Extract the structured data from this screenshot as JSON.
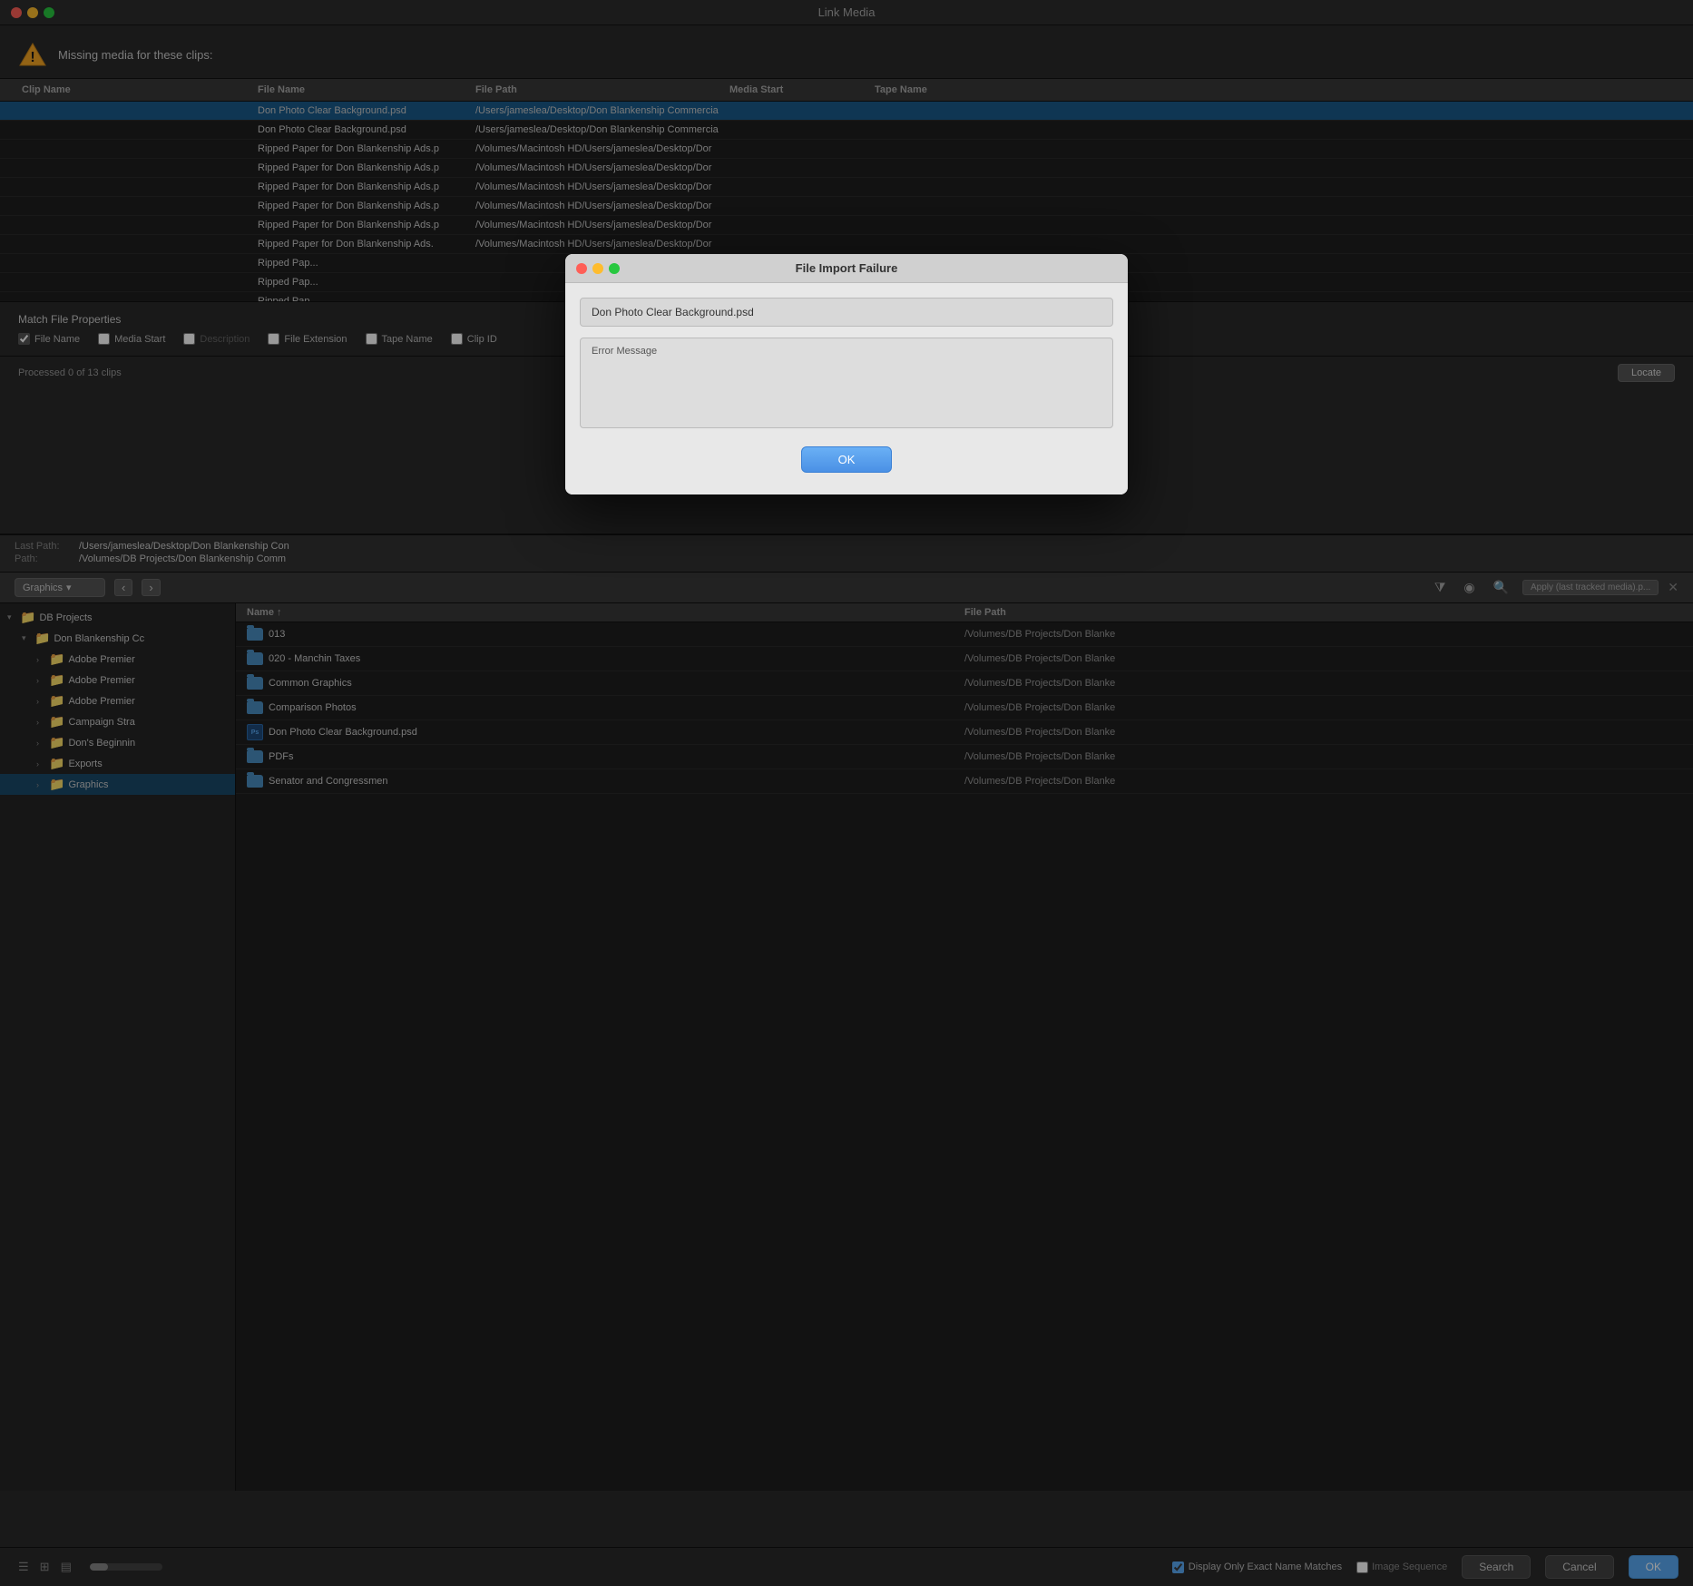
{
  "titleBar": {
    "title": "Link Media",
    "trafficLights": [
      "red",
      "yellow",
      "green"
    ]
  },
  "linkMediaWindow": {
    "missingMediaLabel": "Missing media for these clips:",
    "tableHeaders": {
      "clipName": "Clip Name",
      "fileName": "File Name",
      "filePath": "File Path",
      "mediaStart": "Media Start",
      "tapeName": "Tape Name"
    },
    "tableRows": [
      {
        "clipName": "",
        "fileName": "Don Photo Clear Background.psd",
        "filePath": "/Users/jameslea/Desktop/Don Blankenship Commercia",
        "mediaStart": "",
        "tapeName": "",
        "selected": true
      },
      {
        "clipName": "",
        "fileName": "Don Photo Clear Background.psd",
        "filePath": "/Users/jameslea/Desktop/Don Blankenship Commercia",
        "mediaStart": "",
        "tapeName": "",
        "selected": false
      },
      {
        "clipName": "",
        "fileName": "Ripped Paper for Don Blankenship Ads.p",
        "filePath": "/Volumes/Macintosh HD/Users/jameslea/Desktop/Dor",
        "mediaStart": "",
        "tapeName": "",
        "selected": false
      },
      {
        "clipName": "",
        "fileName": "Ripped Paper for Don Blankenship Ads.p",
        "filePath": "/Volumes/Macintosh HD/Users/jameslea/Desktop/Dor",
        "mediaStart": "",
        "tapeName": "",
        "selected": false
      },
      {
        "clipName": "",
        "fileName": "Ripped Paper for Don Blankenship Ads.p",
        "filePath": "/Volumes/Macintosh HD/Users/jameslea/Desktop/Dor",
        "mediaStart": "",
        "tapeName": "",
        "selected": false
      },
      {
        "clipName": "",
        "fileName": "Ripped Paper for Don Blankenship Ads.p",
        "filePath": "/Volumes/Macintosh HD/Users/jameslea/Desktop/Dor",
        "mediaStart": "",
        "tapeName": "",
        "selected": false
      },
      {
        "clipName": "",
        "fileName": "Ripped Paper for Don Blankenship Ads.p",
        "filePath": "/Volumes/Macintosh HD/Users/jameslea/Desktop/Dor",
        "mediaStart": "",
        "tapeName": "",
        "selected": false
      },
      {
        "clipName": "",
        "fileName": "Ripped Paper for Don Blankenship Ads.",
        "filePath": "/Volumes/Macintosh HD/Users/jameslea/Desktop/Dor",
        "mediaStart": "",
        "tapeName": "",
        "selected": false
      },
      {
        "clipName": "",
        "fileName": "Ripped Pap...",
        "filePath": "",
        "mediaStart": "",
        "tapeName": "",
        "selected": false
      },
      {
        "clipName": "",
        "fileName": "Ripped Pap...",
        "filePath": "",
        "mediaStart": "",
        "tapeName": "",
        "selected": false
      },
      {
        "clipName": "",
        "fileName": "Ripped Pap...",
        "filePath": "",
        "mediaStart": "",
        "tapeName": "",
        "selected": false
      }
    ],
    "matchProperties": {
      "title": "Match File Properties",
      "checkboxes": [
        {
          "id": "fileName",
          "label": "File Name",
          "checked": true,
          "disabled": false
        },
        {
          "id": "mediaStart",
          "label": "Media Start",
          "checked": false,
          "disabled": false
        },
        {
          "id": "description",
          "label": "Description",
          "checked": false,
          "disabled": true
        },
        {
          "id": "fileExtension",
          "label": "File Extension",
          "checked": false,
          "disabled": false
        },
        {
          "id": "tapeName",
          "label": "Tape Name",
          "checked": false,
          "disabled": false
        },
        {
          "id": "clipId",
          "label": "Clip ID",
          "checked": false,
          "disabled": false
        }
      ]
    },
    "processedText": "Processed 0 of 13 clips",
    "locateBtn": "Locate"
  },
  "browserWindow": {
    "lastPathLabel": "Last Path:",
    "lastPathValue": "/Users/jameslea/Desktop/Don Blankenship Con",
    "pathLabel": "Path:",
    "pathValue": "/Volumes/DB Projects/Don Blankenship Comm",
    "locationDropdown": "Graphics",
    "navBack": "‹",
    "navForward": "›",
    "applyText": "Apply (last tracked media).p...",
    "fileListHeaders": {
      "name": "Name ↑",
      "filePath": "File Path"
    },
    "sidebarTree": [
      {
        "label": "DB Projects",
        "level": 0,
        "expanded": true,
        "type": "drive",
        "icon": "📁"
      },
      {
        "label": "Don Blankenship Cc",
        "level": 1,
        "expanded": true,
        "type": "folder",
        "icon": "📁"
      },
      {
        "label": "Adobe Premier",
        "level": 2,
        "expanded": false,
        "type": "folder",
        "icon": "📁"
      },
      {
        "label": "Adobe Premier",
        "level": 2,
        "expanded": false,
        "type": "folder",
        "icon": "📁"
      },
      {
        "label": "Adobe Premier",
        "level": 2,
        "expanded": false,
        "type": "folder",
        "icon": "📁"
      },
      {
        "label": "Campaign Stra",
        "level": 2,
        "expanded": false,
        "type": "folder",
        "icon": "📁"
      },
      {
        "label": "Don's Beginnin",
        "level": 2,
        "expanded": false,
        "type": "folder",
        "icon": "📁"
      },
      {
        "label": "Exports",
        "level": 2,
        "expanded": false,
        "type": "folder",
        "icon": "📁"
      },
      {
        "label": "Graphics",
        "level": 2,
        "expanded": false,
        "type": "folder",
        "icon": "📁",
        "selected": true
      }
    ],
    "fileRows": [
      {
        "name": "013",
        "filePath": "/Volumes/DB Projects/Don Blanke",
        "type": "folder",
        "selected": false
      },
      {
        "name": "020 - Manchin Taxes",
        "filePath": "/Volumes/DB Projects/Don Blanke",
        "type": "folder",
        "selected": false
      },
      {
        "name": "Common Graphics",
        "filePath": "/Volumes/DB Projects/Don Blanke",
        "type": "folder",
        "selected": false
      },
      {
        "name": "Comparison Photos",
        "filePath": "/Volumes/DB Projects/Don Blanke",
        "type": "folder",
        "selected": false
      },
      {
        "name": "Don Photo Clear Background.psd",
        "filePath": "/Volumes/DB Projects/Don Blanke",
        "type": "psd",
        "selected": false
      },
      {
        "name": "PDFs",
        "filePath": "/Volumes/DB Projects/Don Blanke",
        "type": "folder",
        "selected": false
      },
      {
        "name": "Senator and Congressmen",
        "filePath": "/Volumes/DB Projects/Don Blanke",
        "type": "folder",
        "selected": false
      }
    ],
    "bottomBar": {
      "displayExactLabel": "Display Only Exact Name Matches",
      "displayExactChecked": true,
      "imageSequenceLabel": "Image Sequence",
      "imageSequenceChecked": false,
      "searchBtn": "Search",
      "cancelBtn": "Cancel",
      "okBtn": "OK"
    }
  },
  "fileImportDialog": {
    "title": "File Import Failure",
    "filename": "Don Photo Clear Background.psd",
    "errorLabel": "Error Message",
    "okBtn": "OK",
    "trafficLights": [
      "red",
      "yellow",
      "green"
    ]
  }
}
